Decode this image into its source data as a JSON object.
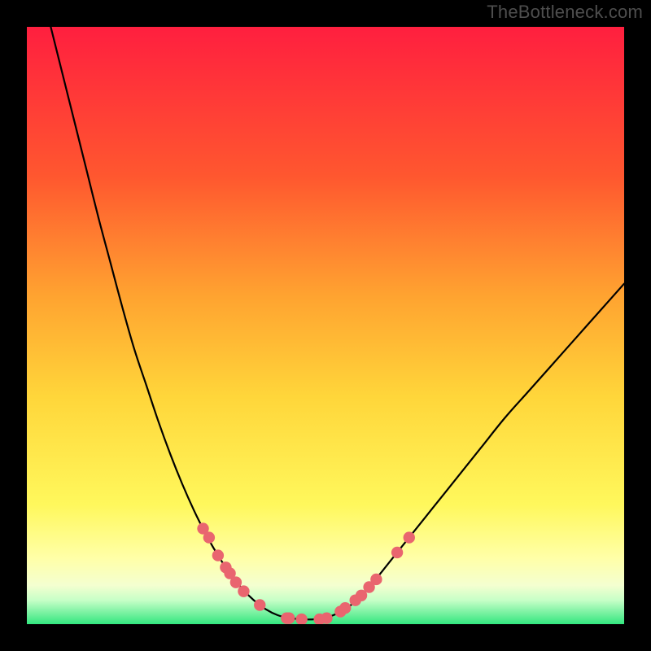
{
  "watermark": "TheBottleneck.com",
  "chart_data": {
    "type": "line",
    "title": "",
    "xlabel": "",
    "ylabel": "",
    "xlim": [
      0,
      100
    ],
    "ylim": [
      0,
      100
    ],
    "grid": false,
    "legend": false,
    "background_gradient": {
      "top": "#ff1f3f",
      "mid_upper": "#ff8a2a",
      "mid": "#ffd63a",
      "mid_lower": "#ffff78",
      "near_bottom": "#f7ffd0",
      "bottom": "#33e77f"
    },
    "series": [
      {
        "name": "bottleneck-curve-left",
        "stroke": "#000000",
        "points": [
          {
            "x": 4.0,
            "y": 100.0
          },
          {
            "x": 6.0,
            "y": 92.0
          },
          {
            "x": 8.0,
            "y": 84.0
          },
          {
            "x": 10.0,
            "y": 76.0
          },
          {
            "x": 12.0,
            "y": 68.0
          },
          {
            "x": 14.0,
            "y": 60.5
          },
          {
            "x": 16.0,
            "y": 53.0
          },
          {
            "x": 18.0,
            "y": 46.0
          },
          {
            "x": 20.0,
            "y": 40.0
          },
          {
            "x": 22.0,
            "y": 34.0
          },
          {
            "x": 24.0,
            "y": 28.5
          },
          {
            "x": 26.0,
            "y": 23.5
          },
          {
            "x": 28.0,
            "y": 19.0
          },
          {
            "x": 30.0,
            "y": 15.0
          },
          {
            "x": 32.0,
            "y": 11.5
          },
          {
            "x": 34.0,
            "y": 8.5
          },
          {
            "x": 36.0,
            "y": 6.0
          },
          {
            "x": 38.0,
            "y": 4.0
          },
          {
            "x": 40.0,
            "y": 2.5
          },
          {
            "x": 42.0,
            "y": 1.5
          },
          {
            "x": 44.0,
            "y": 1.0
          }
        ]
      },
      {
        "name": "bottleneck-curve-flat",
        "stroke": "#000000",
        "points": [
          {
            "x": 44.0,
            "y": 1.0
          },
          {
            "x": 46.0,
            "y": 0.8
          },
          {
            "x": 48.0,
            "y": 0.8
          },
          {
            "x": 50.0,
            "y": 1.0
          }
        ]
      },
      {
        "name": "bottleneck-curve-right",
        "stroke": "#000000",
        "points": [
          {
            "x": 50.0,
            "y": 1.0
          },
          {
            "x": 52.0,
            "y": 1.8
          },
          {
            "x": 54.0,
            "y": 3.0
          },
          {
            "x": 56.0,
            "y": 4.8
          },
          {
            "x": 58.0,
            "y": 7.0
          },
          {
            "x": 60.0,
            "y": 9.5
          },
          {
            "x": 62.0,
            "y": 12.0
          },
          {
            "x": 64.0,
            "y": 14.5
          },
          {
            "x": 68.0,
            "y": 19.5
          },
          {
            "x": 72.0,
            "y": 24.5
          },
          {
            "x": 76.0,
            "y": 29.5
          },
          {
            "x": 80.0,
            "y": 34.5
          },
          {
            "x": 84.0,
            "y": 39.0
          },
          {
            "x": 88.0,
            "y": 43.5
          },
          {
            "x": 92.0,
            "y": 48.0
          },
          {
            "x": 96.0,
            "y": 52.5
          },
          {
            "x": 100.0,
            "y": 57.0
          }
        ]
      }
    ],
    "markers": {
      "name": "highlighted-points",
      "fill": "#e9656f",
      "stroke": "#c94f5a",
      "points": [
        {
          "x": 29.5,
          "y": 16.0
        },
        {
          "x": 30.5,
          "y": 14.5
        },
        {
          "x": 32.0,
          "y": 11.5
        },
        {
          "x": 33.3,
          "y": 9.5
        },
        {
          "x": 34.0,
          "y": 8.5
        },
        {
          "x": 35.0,
          "y": 7.0
        },
        {
          "x": 36.3,
          "y": 5.5
        },
        {
          "x": 39.0,
          "y": 3.2
        },
        {
          "x": 43.5,
          "y": 1.0
        },
        {
          "x": 43.9,
          "y": 1.0
        },
        {
          "x": 46.0,
          "y": 0.8
        },
        {
          "x": 49.0,
          "y": 0.8
        },
        {
          "x": 50.2,
          "y": 1.0
        },
        {
          "x": 52.5,
          "y": 2.1
        },
        {
          "x": 53.3,
          "y": 2.7
        },
        {
          "x": 55.0,
          "y": 4.0
        },
        {
          "x": 56.0,
          "y": 4.8
        },
        {
          "x": 57.3,
          "y": 6.2
        },
        {
          "x": 58.5,
          "y": 7.5
        },
        {
          "x": 62.0,
          "y": 12.0
        },
        {
          "x": 64.0,
          "y": 14.5
        }
      ]
    }
  },
  "colors": {
    "marker_fill": "#e9656f",
    "marker_stroke": "#c94f5a",
    "curve_stroke": "#000000"
  }
}
